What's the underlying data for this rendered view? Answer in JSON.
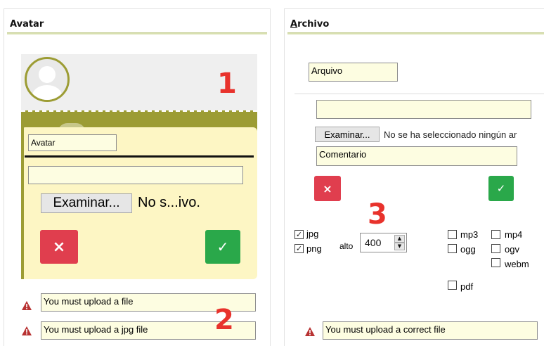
{
  "left_panel": {
    "title": "Avatar",
    "callout_number": "1",
    "avatar_name_value": "Avatar",
    "browse_label": "Examinar...",
    "file_status": "No s...ivo.",
    "cancel_glyph": "×",
    "ok_glyph": "✓",
    "callout_number_2": "2",
    "errors": [
      "You must upload a file",
      "You must upload a jpg file"
    ]
  },
  "right_panel": {
    "title": "Archivo",
    "name_value": "Arquivo",
    "browse_label": "Examinar...",
    "file_status": "No se ha seleccionado ningún ar",
    "comment_value": "Comentario",
    "cancel_glyph": "×",
    "ok_glyph": "✓",
    "callout_number": "3",
    "formats_col1": [
      {
        "label": "jpg",
        "checked": true
      },
      {
        "label": "png",
        "checked": true
      }
    ],
    "height_label": "alto",
    "height_value": "400",
    "formats_col2": [
      {
        "label": "mp3",
        "checked": false
      },
      {
        "label": "ogg",
        "checked": false
      }
    ],
    "formats_col3": [
      {
        "label": "mp4",
        "checked": false
      },
      {
        "label": "ogv",
        "checked": false
      },
      {
        "label": "webm",
        "checked": false
      }
    ],
    "format_pdf": {
      "label": "pdf",
      "checked": false
    },
    "error": "You must upload a correct file"
  },
  "colors": {
    "accent_olive": "#9c9c34",
    "panel_yellow": "#fdf6c4",
    "cancel_red": "#e03e4e",
    "ok_green": "#2aa84a",
    "callout_red": "#e8322c"
  }
}
